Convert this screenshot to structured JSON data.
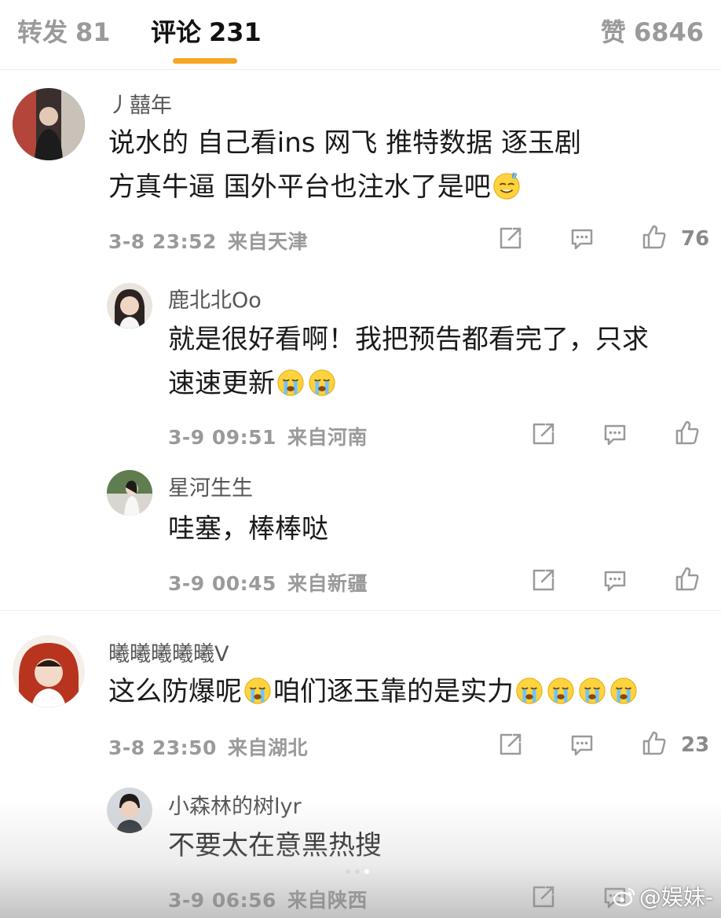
{
  "tabs": {
    "repost": {
      "label": "转发",
      "count": "81"
    },
    "comment": {
      "label": "评论",
      "count": "231"
    },
    "like": {
      "label": "赞",
      "count": "6846"
    }
  },
  "comments": [
    {
      "username": "丿囍年",
      "text_lines": [
        "说水的  自己看ins  网飞  推特数据  逐玉剧",
        "方真牛逼  国外平台也注水了是吧"
      ],
      "time": "3-8 23:52",
      "location": "来自天津",
      "likes": "76",
      "replies": [
        {
          "username": "鹿北北Oo",
          "text_lines": [
            "就是很好看啊！我把预告都看完了，只求",
            "速速更新"
          ],
          "time": "3-9 09:51",
          "location": "来自河南"
        },
        {
          "username": "星河生生",
          "text_lines": [
            "哇塞，棒棒哒"
          ],
          "time": "3-9 00:45",
          "location": "来自新疆"
        }
      ]
    },
    {
      "username": "曦曦曦曦曦V",
      "text_lines": [
        "这么防爆呢",
        "咱们逐玉靠的是实力"
      ],
      "time": "3-8 23:50",
      "location": "来自湖北",
      "likes": "23",
      "replies": [
        {
          "username": "小森林的树lyr",
          "text_lines": [
            "不要太在意黑热搜"
          ],
          "time": "3-9 06:56",
          "location": "来自陕西"
        }
      ]
    }
  ],
  "icons": {
    "share": "share-icon",
    "comment": "comment-bubble-icon",
    "like": "thumbs-up-icon",
    "emoji_sweat": "sweat-smile-emoji",
    "emoji_cry": "crying-emoji"
  },
  "colors": {
    "accent": "#f6a623",
    "muted": "#9a9a9a",
    "text": "#1a1a1a"
  },
  "watermark": {
    "text": "@娱妹-"
  }
}
